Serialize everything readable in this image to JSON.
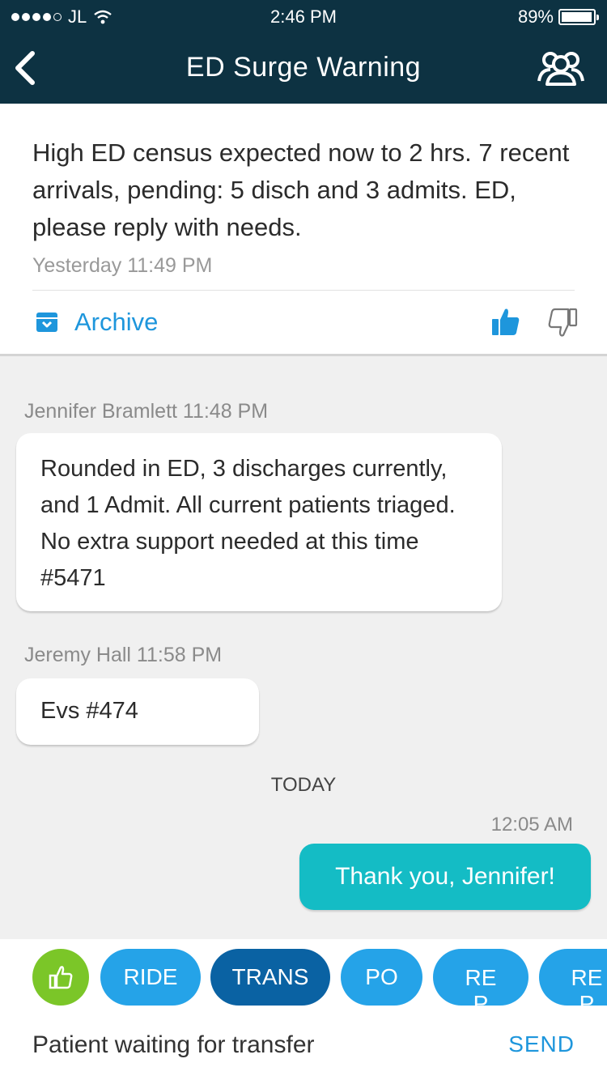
{
  "status_bar": {
    "carrier": "JL",
    "time": "2:46 PM",
    "battery": "89%",
    "battery_level": 0.89
  },
  "nav": {
    "title": "ED Surge Warning",
    "back_icon": "chevron-left-icon",
    "group_icon": "group-icon"
  },
  "alert": {
    "message": "High ED census expected now to 2 hrs. 7 recent arrivals, pending: 5 disch and 3 admits. ED, please reply with needs.",
    "timestamp": "Yesterday 11:49 PM",
    "archive_label": "Archive"
  },
  "messages": [
    {
      "sender": "Jennifer Bramlett 11:48 PM",
      "text": "Rounded in ED, 3 discharges currently, and 1 Admit. All current patients triaged. No extra support needed at this time #5471"
    },
    {
      "sender": "Jeremy Hall 11:58 PM",
      "text": "Evs #474"
    }
  ],
  "day_divider": "TODAY",
  "my_message": {
    "time": "12:05 AM",
    "text": "Thank you, Jennifer!"
  },
  "quick_replies": [
    "RIDE",
    "TRANS",
    "PO",
    "RE\nP",
    "RE\nP"
  ],
  "composer": {
    "text": "Patient waiting for transfer",
    "send_label": "SEND"
  },
  "colors": {
    "nav_bg": "#0d3242",
    "accent": "#1e96dc",
    "my_bubble": "#14bcc5",
    "like_green": "#7bc628",
    "pill_blue": "#25a3e8",
    "pill_selected": "#0a62a3"
  }
}
